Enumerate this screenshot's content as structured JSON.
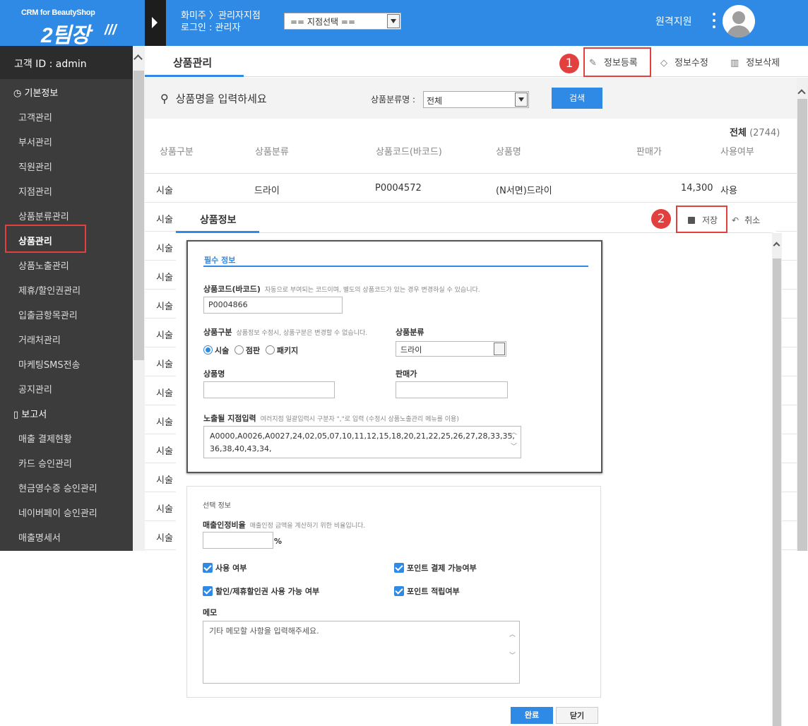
{
  "header": {
    "brand_sub": "CRM for BeautyShop",
    "brand_logo": "2팀장",
    "brand_slash": "///",
    "branch_line1": "화미주 〉관리자지점",
    "branch_line2": "로그인 : 관리자",
    "branch_select": "== 지점선택 ==",
    "remote_label": "원격지원",
    "accent": "#2f8ae5"
  },
  "sidebar": {
    "customer_id": "고객 ID : admin",
    "group1": "기본정보",
    "group2": "보고서",
    "items1": [
      "고객관리",
      "부서관리",
      "직원관리",
      "지점관리",
      "상품분류관리",
      "상품관리",
      "상품노출관리",
      "제휴/할인권관리",
      "입출금항목관리",
      "거래처관리",
      "마케팅SMS전송",
      "공지관리"
    ],
    "items2": [
      "매출 결제현황",
      "카드 승인관리",
      "현금영수증 승인관리",
      "네이버페이 승인관리",
      "매출명세서"
    ]
  },
  "main": {
    "tab": "상품관리",
    "register": "정보등록",
    "edit": "정보수정",
    "delete": "정보삭제",
    "badge1": "1",
    "search_placeholder": "상품명을 입력하세요",
    "category_label": "상품분류명 :",
    "category_value": "전체",
    "search_button": "검색",
    "total_label": "전체",
    "total_count": "(2744)",
    "columns": [
      "상품구분",
      "상품분류",
      "상품코드(바코드)",
      "상품명",
      "판매가",
      "사용여부"
    ],
    "first_row": {
      "type": "시술",
      "category": "드라이",
      "code": "P0004572",
      "name": "(N서면)드라이",
      "price": "14,300",
      "use": "사용"
    },
    "row_type": "시술"
  },
  "dialog": {
    "tab": "상품정보",
    "save": "저장",
    "cancel": "취소",
    "badge2": "2",
    "required_title": "필수 정보",
    "code_label": "상품코드(바코드)",
    "code_help": "자동으로 부여되는 코드이며, 별도의 상품코드가 있는 경우 변경하실 수 있습니다.",
    "code_value": "P0004866",
    "type_label": "상품구분",
    "type_help": "상품정보 수정시, 상품구분은 변경할 수 없습니다.",
    "type_opt1": "시술",
    "type_opt2": "점판",
    "type_opt3": "패키지",
    "category_label": "상품분류",
    "category_value": "드라이",
    "name_label": "상품명",
    "price_label": "판매가",
    "branch_label": "노출될 지점입력",
    "branch_help": "여러지점 일괄입력시 구분자 \",\"로 입력 (수정시 상품노출관리 메뉴를 이용)",
    "branch_line1": "A0000,A0026,A0027,24,02,05,07,10,11,12,15,18,20,21,22,25,26,27,28,33,35,",
    "branch_line2": "36,38,40,43,34,",
    "optional_title": "선택 정보",
    "ratio_label": "매출인정비율",
    "ratio_help": "매출인정 금액을 계산하기 위한 비율입니다.",
    "ratio_unit": "%",
    "chk_use": "사용 여부",
    "chk_point_pay": "포인트 결제 가능여부",
    "chk_discount": "할인/제휴할인권 사용 가능 여부",
    "chk_point_save": "포인트 적립여부",
    "memo_label": "메모",
    "memo_placeholder": "기타 메모할 사항을 입력해주세요.",
    "done": "완료",
    "close": "닫기"
  }
}
